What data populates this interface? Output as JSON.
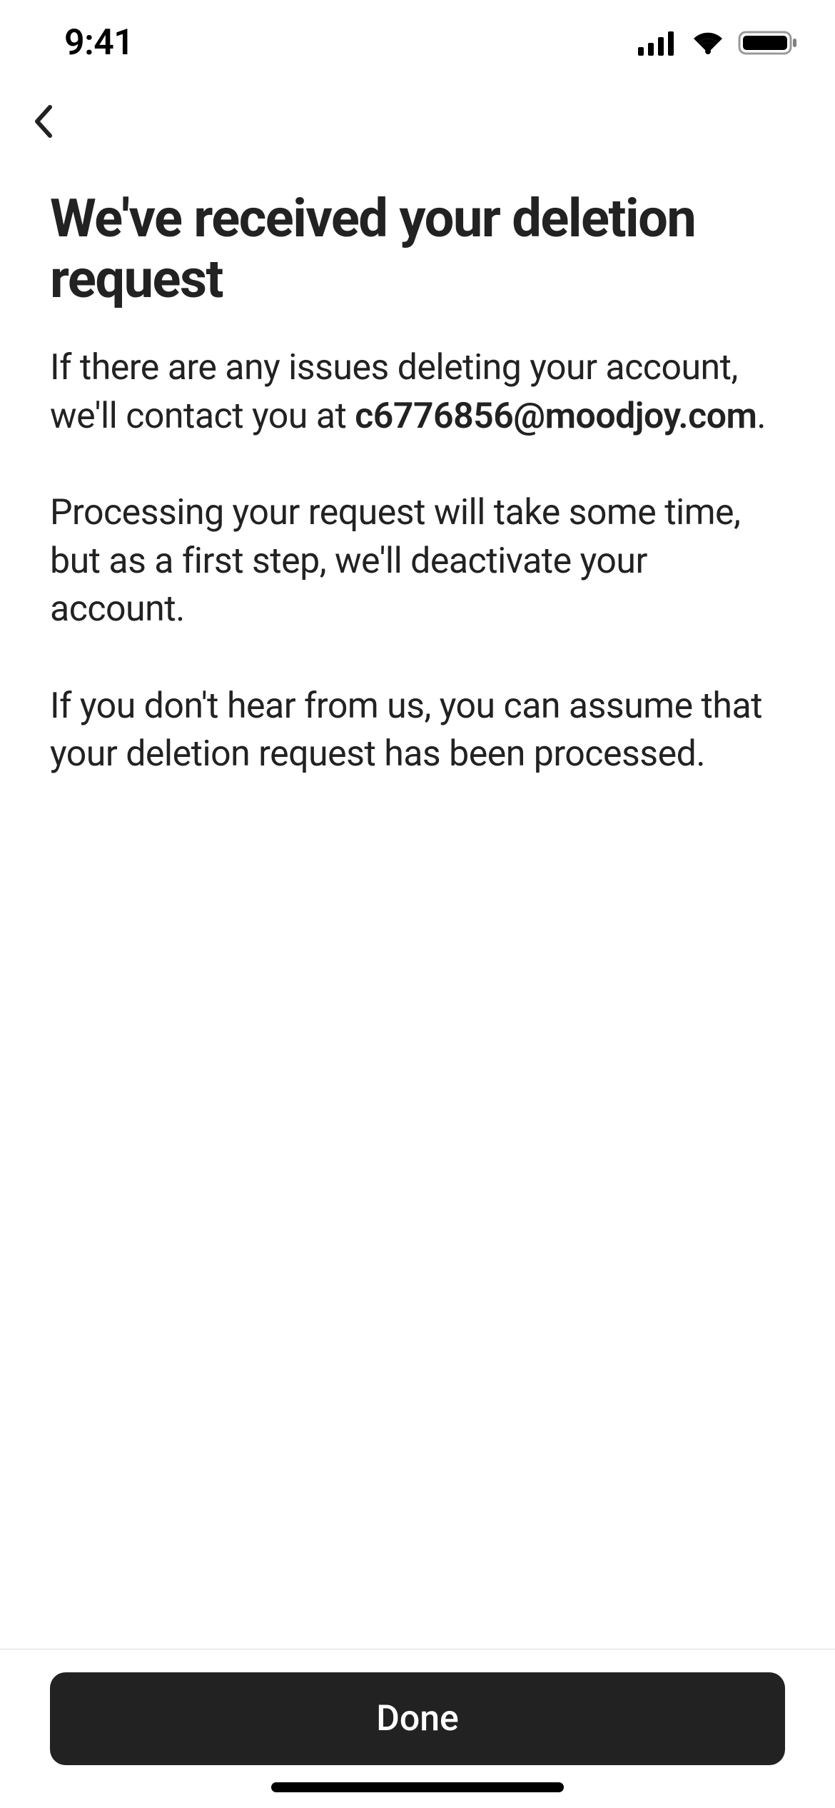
{
  "statusBar": {
    "time": "9:41"
  },
  "page": {
    "title": "We've received your deletion request",
    "paragraph1_part1": "If there are any issues deleting your account, we'll contact you at ",
    "paragraph1_email": "c6776856@moodjoy.com",
    "paragraph1_part2": ".",
    "paragraph2": "Processing your request will take some time, but as a first step, we'll deactivate your account.",
    "paragraph3": "If you don't hear from us, you can assume that your deletion request has been processed."
  },
  "footer": {
    "doneLabel": "Done"
  }
}
